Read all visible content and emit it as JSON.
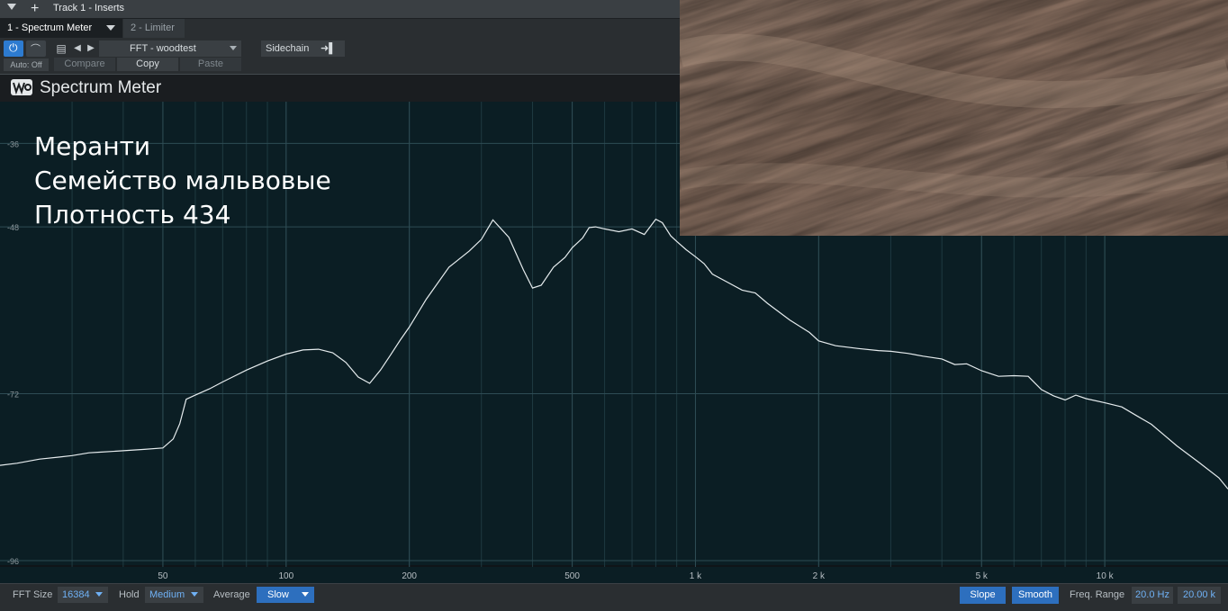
{
  "window": {
    "title": "Track 1 - Inserts"
  },
  "tabs": [
    {
      "label": "1 - Spectrum Meter",
      "active": true
    },
    {
      "label": "2 - Limiter",
      "active": false
    }
  ],
  "toolbar": {
    "auto_label": "Auto: Off",
    "preset_name": "FFT - woodtest",
    "sidechain_label": "Sidechain",
    "compare_label": "Compare",
    "copy_label": "Copy",
    "paste_label": "Paste"
  },
  "plugin": {
    "title": "Spectrum Meter"
  },
  "overlay": {
    "line1": "Меранти",
    "line2": "Семейство мальвовые",
    "line3": "Плотность 434"
  },
  "chart_data": {
    "type": "line",
    "x_scale": "log",
    "xlim": [
      20,
      20000
    ],
    "ylim": [
      -96,
      -30
    ],
    "x_ticks": [
      {
        "value": 50,
        "label": "50"
      },
      {
        "value": 100,
        "label": "100"
      },
      {
        "value": 200,
        "label": "200"
      },
      {
        "value": 500,
        "label": "500"
      },
      {
        "value": 1000,
        "label": "1 k"
      },
      {
        "value": 2000,
        "label": "2 k"
      },
      {
        "value": 5000,
        "label": "5 k"
      },
      {
        "value": 10000,
        "label": "10 k"
      }
    ],
    "y_ticks": [
      {
        "value": -36,
        "label": "-36"
      },
      {
        "value": -48,
        "label": "-48"
      },
      {
        "value": -72,
        "label": "-72"
      },
      {
        "value": -96,
        "label": "-96"
      }
    ],
    "x": [
      20,
      22,
      25,
      28,
      30,
      33,
      35,
      40,
      45,
      50,
      53,
      55,
      57,
      60,
      65,
      70,
      80,
      90,
      100,
      110,
      120,
      130,
      140,
      150,
      160,
      170,
      180,
      190,
      200,
      220,
      250,
      280,
      300,
      320,
      350,
      380,
      400,
      420,
      450,
      480,
      500,
      530,
      550,
      570,
      600,
      650,
      700,
      750,
      800,
      830,
      870,
      900,
      950,
      1000,
      1050,
      1100,
      1200,
      1300,
      1400,
      1500,
      1700,
      1900,
      2000,
      2200,
      2500,
      2800,
      3000,
      3300,
      3600,
      4000,
      4300,
      4600,
      5000,
      5500,
      6000,
      6500,
      7000,
      7500,
      8000,
      8500,
      9000,
      10000,
      11000,
      12000,
      13000,
      14000,
      15000,
      17000,
      19000,
      20000
    ],
    "y": [
      -82.3,
      -82,
      -81.4,
      -81.1,
      -80.9,
      -80.5,
      -80.4,
      -80.2,
      -80,
      -79.8,
      -78.5,
      -76.3,
      -72.8,
      -72.2,
      -71.3,
      -70.3,
      -68.6,
      -67.3,
      -66.3,
      -65.7,
      -65.6,
      -66.1,
      -67.5,
      -69.6,
      -70.5,
      -68.6,
      -66.4,
      -64.3,
      -62.4,
      -58.4,
      -53.8,
      -51.5,
      -49.8,
      -47,
      -49.5,
      -54.2,
      -56.8,
      -56.4,
      -53.8,
      -52.4,
      -51,
      -49.6,
      -48.1,
      -48,
      -48.3,
      -48.7,
      -48.3,
      -49.1,
      -46.9,
      -47.4,
      -49.3,
      -50.1,
      -51.3,
      -52.3,
      -53.3,
      -54.8,
      -56,
      -57.1,
      -57.5,
      -59,
      -61.4,
      -63.2,
      -64.4,
      -65.1,
      -65.5,
      -65.8,
      -65.9,
      -66.2,
      -66.6,
      -67,
      -67.8,
      -67.7,
      -68.7,
      -69.5,
      -69.4,
      -69.5,
      -71.4,
      -72.3,
      -72.9,
      -72.2,
      -72.7,
      -73.3,
      -73.9,
      -75.2,
      -76.4,
      -78,
      -79.5,
      -81.9,
      -84.1,
      -85.7
    ]
  },
  "bottom_bar": {
    "fft_size_label": "FFT Size",
    "fft_size_value": "16384",
    "hold_label": "Hold",
    "hold_value": "Medium",
    "average_label": "Average",
    "average_value": "Slow",
    "slope_label": "Slope",
    "smooth_label": "Smooth",
    "freq_range_label": "Freq. Range",
    "freq_min": "20.0 Hz",
    "freq_max": "20.00 k"
  },
  "colors": {
    "graph_background": "#0b1e24",
    "curve": "#e6ecee",
    "accent": "#2d7bd0"
  }
}
